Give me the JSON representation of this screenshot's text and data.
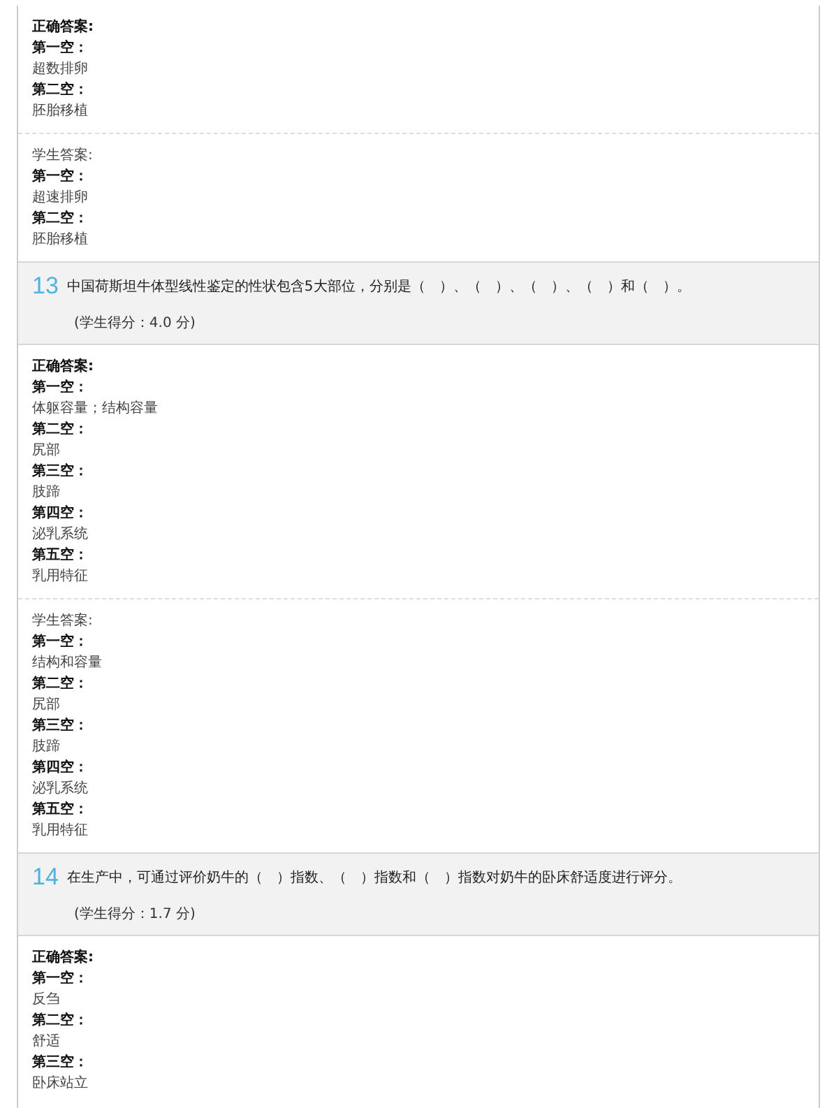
{
  "blocks": [
    {
      "kind": "correct",
      "label": "正确答案:",
      "blanks": [
        {
          "label": "第一空：",
          "value": "超数排卵"
        },
        {
          "label": "第二空：",
          "value": "胚胎移植"
        }
      ]
    },
    {
      "kind": "student",
      "label": "学生答案:",
      "blanks": [
        {
          "label": "第一空：",
          "value": "超速排卵"
        },
        {
          "label": "第二空：",
          "value": "胚胎移植"
        }
      ]
    },
    {
      "kind": "question",
      "number": "13",
      "text": "中国荷斯坦牛体型线性鉴定的性状包含5大部位，分别是（　）、（　）、（　）、（　）和（　）。",
      "score": "(学生得分：4.0 分)"
    },
    {
      "kind": "correct",
      "label": "正确答案:",
      "blanks": [
        {
          "label": "第一空：",
          "value": "体躯容量；结构容量"
        },
        {
          "label": "第二空：",
          "value": "尻部"
        },
        {
          "label": "第三空：",
          "value": "肢蹄"
        },
        {
          "label": "第四空：",
          "value": "泌乳系统"
        },
        {
          "label": "第五空：",
          "value": "乳用特征"
        }
      ]
    },
    {
      "kind": "student",
      "label": "学生答案:",
      "blanks": [
        {
          "label": "第一空：",
          "value": "结构和容量"
        },
        {
          "label": "第二空：",
          "value": "尻部"
        },
        {
          "label": "第三空：",
          "value": "肢蹄"
        },
        {
          "label": "第四空：",
          "value": "泌乳系统"
        },
        {
          "label": "第五空：",
          "value": "乳用特征"
        }
      ]
    },
    {
      "kind": "question",
      "number": "14",
      "text": "在生产中，可通过评价奶牛的（　）指数、（　）指数和（　）指数对奶牛的卧床舒适度进行评分。",
      "score": "(学生得分：1.7 分)"
    },
    {
      "kind": "correct",
      "label": "正确答案:",
      "blanks": [
        {
          "label": "第一空：",
          "value": "反刍"
        },
        {
          "label": "第二空：",
          "value": "舒适"
        },
        {
          "label": "第三空：",
          "value": "卧床站立"
        }
      ]
    }
  ]
}
